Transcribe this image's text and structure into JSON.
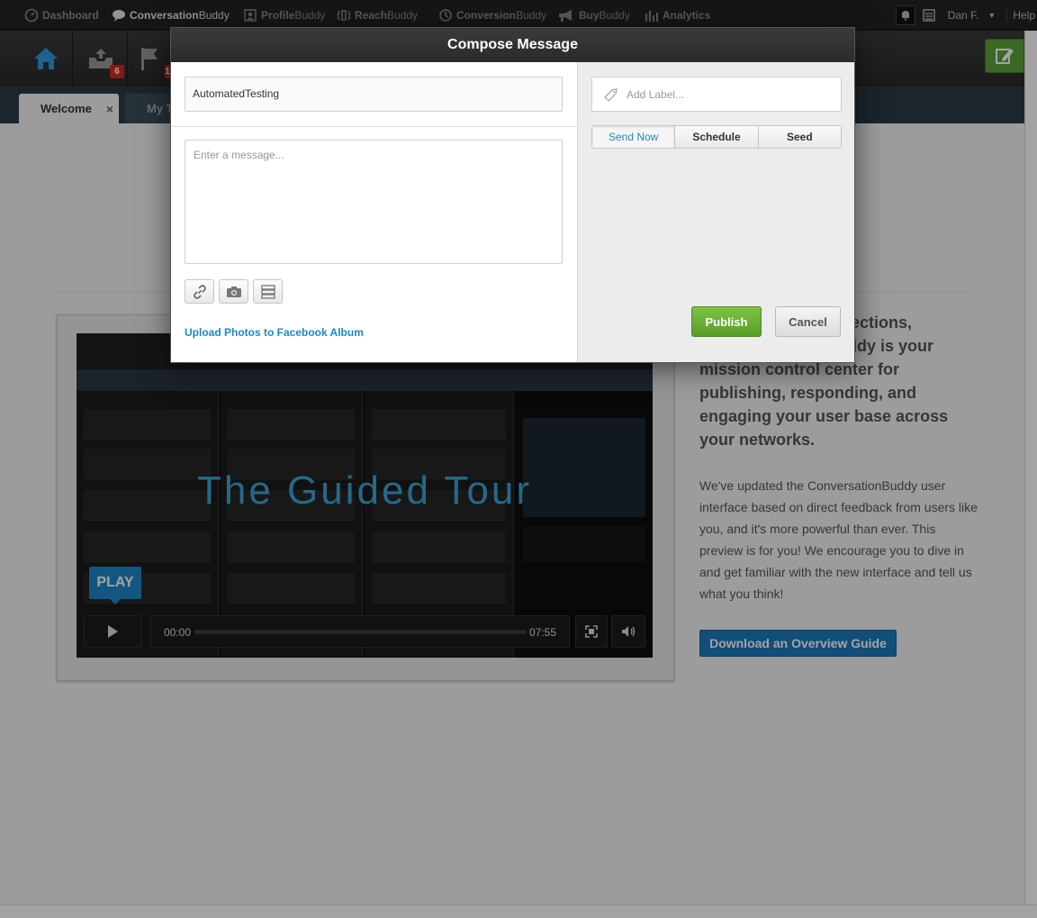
{
  "nav": {
    "items": [
      {
        "label_bold": "Dashboard",
        "label_light": "",
        "icon": "dashboard-icon"
      },
      {
        "label_bold": "Conversation",
        "label_light": "Buddy",
        "icon": "chat-bubble-icon"
      },
      {
        "label_bold": "Profile",
        "label_light": "Buddy",
        "icon": "profile-icon"
      },
      {
        "label_bold": "Reach",
        "label_light": "Buddy",
        "icon": "reach-icon"
      },
      {
        "label_bold": "Conversion",
        "label_light": "Buddy",
        "icon": "conversion-icon"
      },
      {
        "label_bold": "Buy",
        "label_light": "Buddy",
        "icon": "megaphone-icon"
      },
      {
        "label_bold": "Analytics",
        "label_light": "",
        "icon": "bar-chart-icon"
      }
    ],
    "user": "Dan F.",
    "help": "Help"
  },
  "toolbar": {
    "inbox_count": "6",
    "flag_count": "1"
  },
  "tabs": {
    "welcome": "Welcome",
    "close": "×",
    "my_tab": "My T"
  },
  "video": {
    "title": "The Guided Tour",
    "play_label": "PLAY",
    "time_current": "00:00",
    "time_total": "07:55"
  },
  "intro": {
    "headline": "er connections, ddy is your mission control center for publishing, responding, and engaging your user base across your networks.",
    "headline_line1": "er connections,",
    "headline_line2": "ddy is your",
    "headline_line3": "mission control center for",
    "headline_line4": "publishing, responding, and",
    "headline_line5": "engaging your user base across",
    "headline_line6": "your networks.",
    "body": "We've updated the ConversationBuddy user interface based on direct feedback from users like you, and it's more powerful than ever. This preview is for you! We encourage you to dive in and get familiar with the new interface and tell us what you think!",
    "download_label": "Download an Overview Guide"
  },
  "modal": {
    "title": "Compose Message",
    "account": "AutomatedTesting",
    "message_placeholder": "Enter a message...",
    "label_placeholder": "Add Label...",
    "upload_link": "Upload Photos to Facebook Album",
    "segments": [
      "Send Now",
      "Schedule",
      "Seed"
    ],
    "publish_label": "Publish",
    "cancel_label": "Cancel"
  },
  "colors": {
    "accent_blue": "#1f87c7",
    "publish_green": "#6cb43a",
    "badge_red": "#d12a1f",
    "nav_dark": "#232323"
  }
}
